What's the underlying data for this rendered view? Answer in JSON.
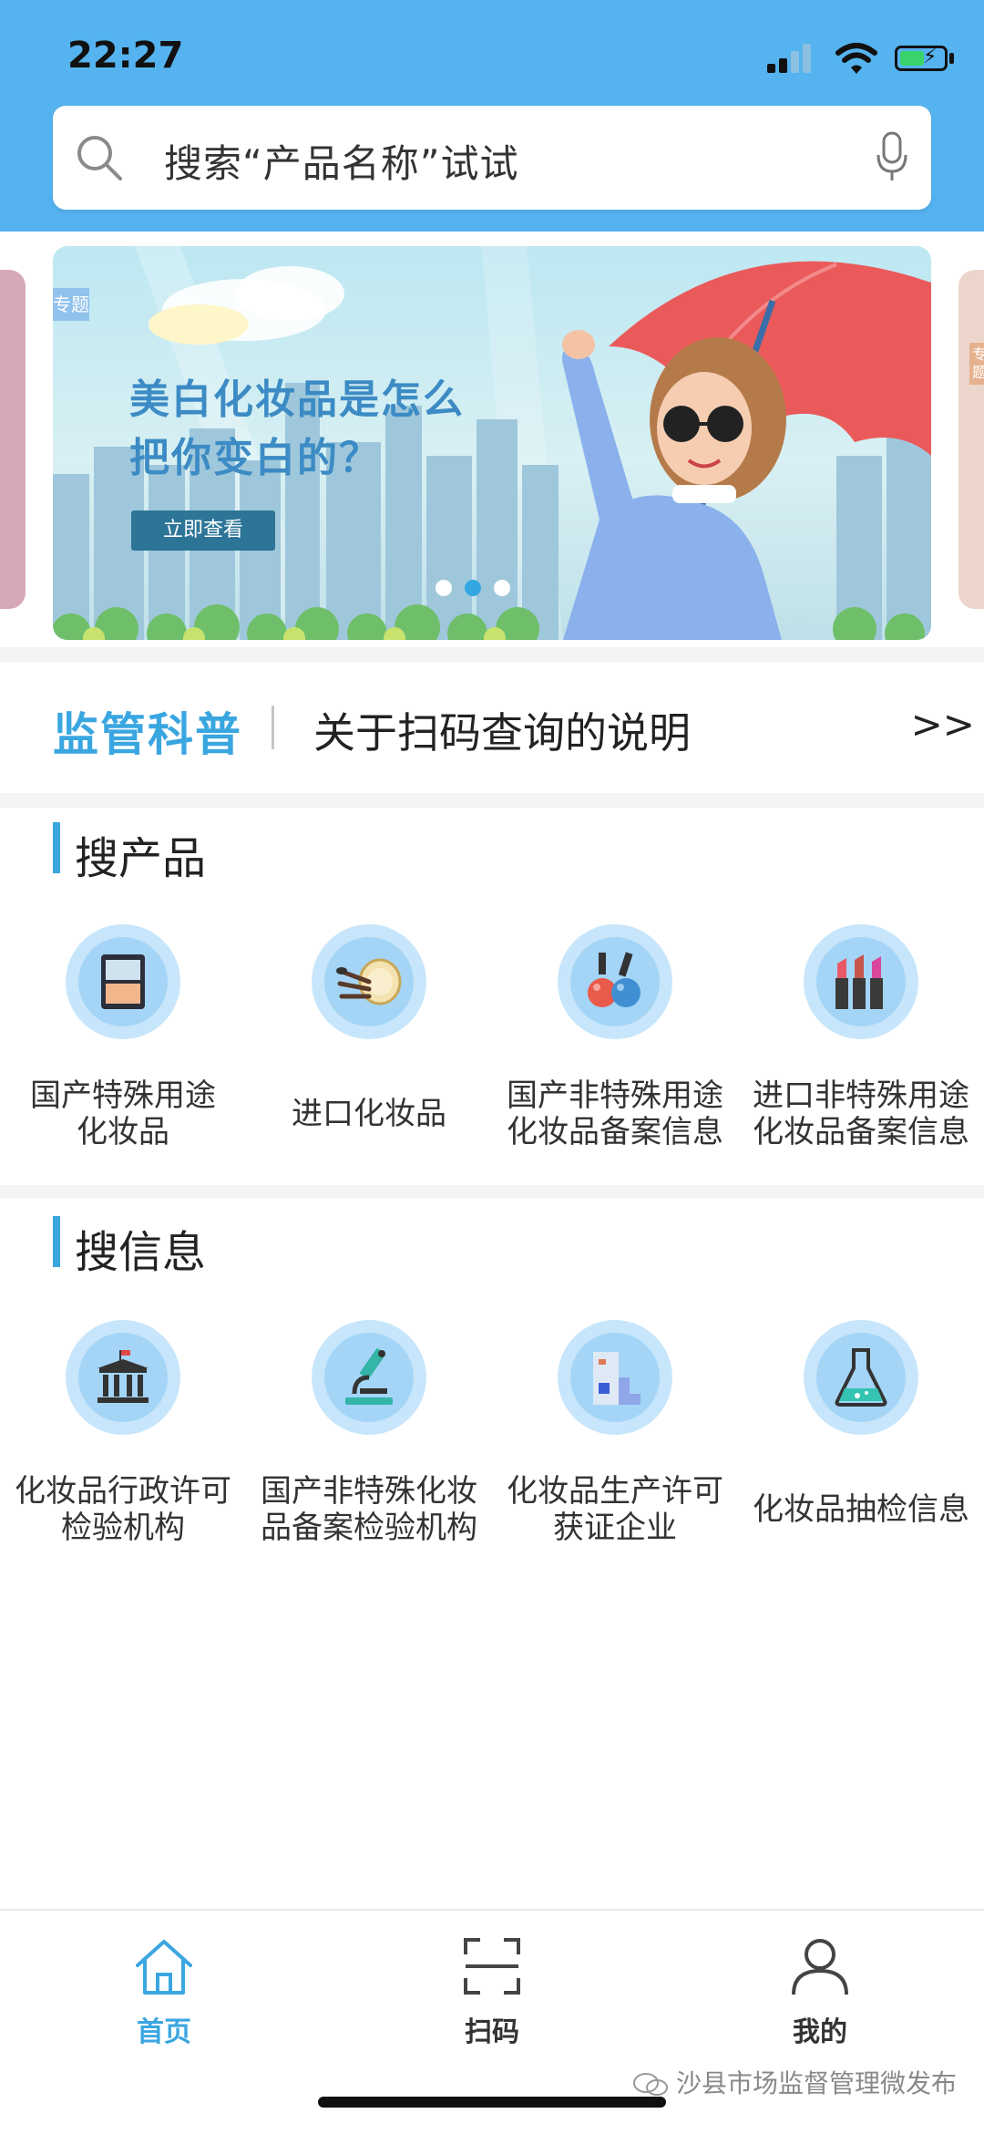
{
  "status_bar": {
    "time": "22:27"
  },
  "search": {
    "placeholder": "搜索“产品名称”试试"
  },
  "banner": {
    "tag": "专题",
    "title_line1": "美白化妆品是怎么",
    "title_line2": "把你变白的？",
    "cta": "立即查看",
    "slide_count": 3,
    "active_slide": 2,
    "next_tag": "专题"
  },
  "notice": {
    "label": "监管科普",
    "text": "关于扫码查询的说明",
    "more": ">>"
  },
  "sections": {
    "products": {
      "title": "搜产品",
      "items": [
        {
          "line1": "国产特殊用途",
          "line2": "化妆品",
          "icon": "foundation-icon"
        },
        {
          "line1": "进口化妆品",
          "line2": "",
          "icon": "makeup-brush-icon"
        },
        {
          "line1": "国产非特殊用途",
          "line2": "化妆品备案信息",
          "icon": "nail-polish-icon"
        },
        {
          "line1": "进口非特殊用途",
          "line2": "化妆品备案信息",
          "icon": "lipstick-icon"
        }
      ]
    },
    "info": {
      "title": "搜信息",
      "items": [
        {
          "line1": "化妆品行政许可",
          "line2": "检验机构",
          "icon": "institution-icon"
        },
        {
          "line1": "国产非特殊化妆",
          "line2": "品备案检验机构",
          "icon": "microscope-icon"
        },
        {
          "line1": "化妆品生产许可",
          "line2": "获证企业",
          "icon": "factory-icon"
        },
        {
          "line1": "化妆品抽检信息",
          "line2": "",
          "icon": "flask-icon"
        }
      ]
    }
  },
  "tabbar": {
    "tabs": [
      {
        "label": "首页",
        "icon": "home-icon",
        "active": true
      },
      {
        "label": "扫码",
        "icon": "scan-icon",
        "active": false
      },
      {
        "label": "我的",
        "icon": "user-icon",
        "active": false
      }
    ]
  },
  "watermark": "沙县市场监督管理微发布",
  "colors": {
    "header": "#55b3ef",
    "accent": "#3aa6e0",
    "active_tab": "#3aa6e0"
  }
}
